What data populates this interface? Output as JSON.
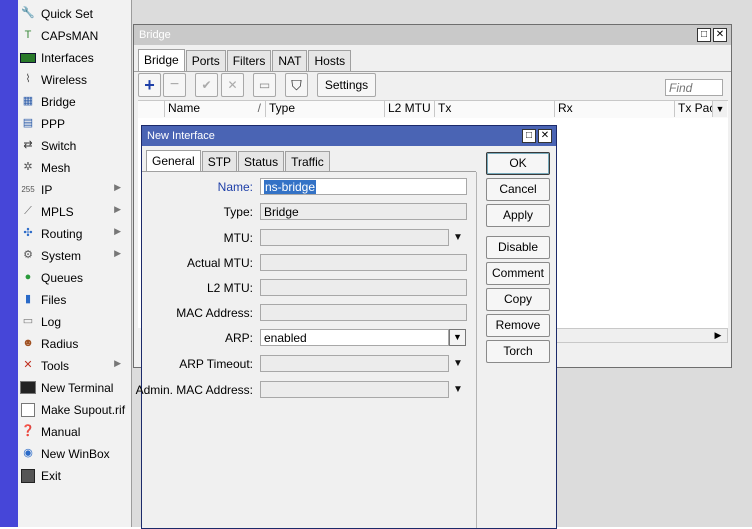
{
  "menu": [
    {
      "label": "Quick Set",
      "icon": "quick-set-icon",
      "arrow": false
    },
    {
      "label": "CAPsMAN",
      "icon": "capsman-icon",
      "arrow": false
    },
    {
      "label": "Interfaces",
      "icon": "interfaces-icon",
      "arrow": false
    },
    {
      "label": "Wireless",
      "icon": "wireless-icon",
      "arrow": false
    },
    {
      "label": "Bridge",
      "icon": "bridge-icon",
      "arrow": false
    },
    {
      "label": "PPP",
      "icon": "ppp-icon",
      "arrow": false
    },
    {
      "label": "Switch",
      "icon": "switch-icon",
      "arrow": false
    },
    {
      "label": "Mesh",
      "icon": "mesh-icon",
      "arrow": false
    },
    {
      "label": "IP",
      "icon": "ip-icon",
      "arrow": true
    },
    {
      "label": "MPLS",
      "icon": "mpls-icon",
      "arrow": true
    },
    {
      "label": "Routing",
      "icon": "routing-icon",
      "arrow": true
    },
    {
      "label": "System",
      "icon": "system-icon",
      "arrow": true
    },
    {
      "label": "Queues",
      "icon": "queues-icon",
      "arrow": false
    },
    {
      "label": "Files",
      "icon": "files-icon",
      "arrow": false
    },
    {
      "label": "Log",
      "icon": "log-icon",
      "arrow": false
    },
    {
      "label": "Radius",
      "icon": "radius-icon",
      "arrow": false
    },
    {
      "label": "Tools",
      "icon": "tools-icon",
      "arrow": true
    },
    {
      "label": "New Terminal",
      "icon": "terminal-icon",
      "arrow": false
    },
    {
      "label": "Make Supout.rif",
      "icon": "supout-icon",
      "arrow": false
    },
    {
      "label": "Manual",
      "icon": "manual-icon",
      "arrow": false
    },
    {
      "label": "New WinBox",
      "icon": "winbox-icon",
      "arrow": false
    },
    {
      "label": "Exit",
      "icon": "exit-icon",
      "arrow": false
    }
  ],
  "bridge": {
    "title": "Bridge",
    "tabs": [
      "Bridge",
      "Ports",
      "Filters",
      "NAT",
      "Hosts"
    ],
    "settings_label": "Settings",
    "find_placeholder": "Find",
    "columns": [
      "Name",
      "Type",
      "L2 MTU",
      "Tx",
      "Rx",
      "Tx Pac"
    ]
  },
  "dialog": {
    "title": "New Interface",
    "tabs": [
      "General",
      "STP",
      "Status",
      "Traffic"
    ],
    "fields": {
      "name": {
        "label": "Name:",
        "value": "ns-bridge"
      },
      "type": {
        "label": "Type:",
        "value": "Bridge"
      },
      "mtu": {
        "label": "MTU:",
        "value": ""
      },
      "actual_mtu": {
        "label": "Actual MTU:",
        "value": ""
      },
      "l2_mtu": {
        "label": "L2 MTU:",
        "value": ""
      },
      "mac": {
        "label": "MAC Address:",
        "value": ""
      },
      "arp": {
        "label": "ARP:",
        "value": "enabled"
      },
      "arp_timeout": {
        "label": "ARP Timeout:",
        "value": ""
      },
      "admin_mac": {
        "label": "Admin. MAC Address:",
        "value": ""
      }
    },
    "buttons": [
      "OK",
      "Cancel",
      "Apply",
      "Disable",
      "Comment",
      "Copy",
      "Remove",
      "Torch"
    ]
  },
  "colors": {
    "strip": "#4646d8",
    "bridge_title_bg": "#c9c9c9",
    "dialog_title_bg": "#4a64b4",
    "selection": "#3372c6"
  }
}
